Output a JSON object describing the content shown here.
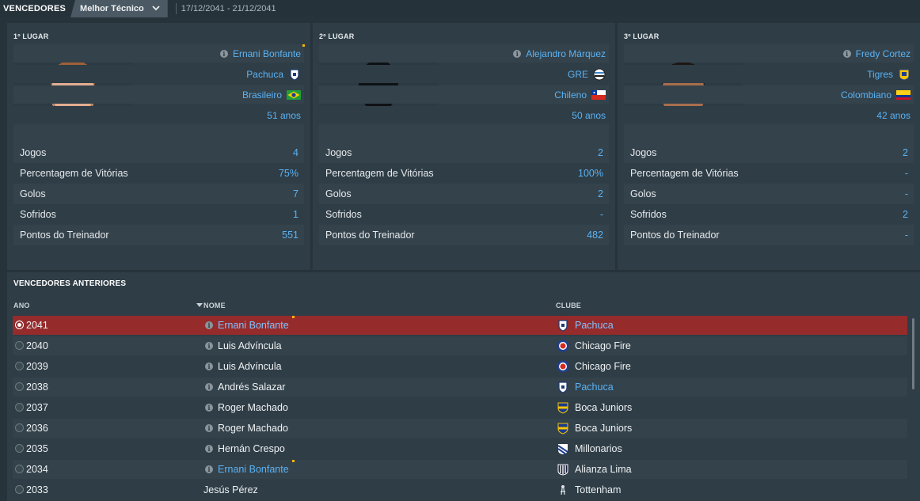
{
  "topbar": {
    "title": "VENCEDORES",
    "dropdown_label": "Melhor Técnico",
    "dates": "17/12/2041 - 21/12/2041"
  },
  "podium": [
    {
      "place": "1º LUGAR",
      "name": "Ernani Bonfante",
      "club": "Pachuca",
      "nationality": "Brasileiro",
      "age": "51 anos",
      "stats": [
        {
          "label": "Jogos",
          "value": "4"
        },
        {
          "label": "Percentagem de Vitórias",
          "value": "75%"
        },
        {
          "label": "Golos",
          "value": "7"
        },
        {
          "label": "Sofridos",
          "value": "1"
        },
        {
          "label": "Pontos do Treinador",
          "value": "551"
        }
      ]
    },
    {
      "place": "2º LUGAR",
      "name": "Alejandro Márquez",
      "club": "GRE",
      "nationality": "Chileno",
      "age": "50 anos",
      "stats": [
        {
          "label": "Jogos",
          "value": "2"
        },
        {
          "label": "Percentagem de Vitórias",
          "value": "100%"
        },
        {
          "label": "Golos",
          "value": "2"
        },
        {
          "label": "Sofridos",
          "value": "-"
        },
        {
          "label": "Pontos do Treinador",
          "value": "482"
        }
      ]
    },
    {
      "place": "3º LUGAR",
      "name": "Fredy Cortez",
      "club": "Tigres",
      "nationality": "Colombiano",
      "age": "42 anos",
      "stats": [
        {
          "label": "Jogos",
          "value": "2"
        },
        {
          "label": "Percentagem de Vitórias",
          "value": "-"
        },
        {
          "label": "Golos",
          "value": "-"
        },
        {
          "label": "Sofridos",
          "value": "2"
        },
        {
          "label": "Pontos do Treinador",
          "value": "-"
        }
      ]
    }
  ],
  "previous": {
    "title": "VENCEDORES ANTERIORES",
    "columns": {
      "year": "ANO",
      "name": "NOME",
      "club": "CLUBE"
    },
    "rows": [
      {
        "year": "2041",
        "name": "Ernani Bonfante",
        "club": "Pachuca"
      },
      {
        "year": "2040",
        "name": "Luis Advíncula",
        "club": "Chicago Fire"
      },
      {
        "year": "2039",
        "name": "Luis Advíncula",
        "club": "Chicago Fire"
      },
      {
        "year": "2038",
        "name": "Andrés Salazar",
        "club": "Pachuca"
      },
      {
        "year": "2037",
        "name": "Roger Machado",
        "club": "Boca Juniors"
      },
      {
        "year": "2036",
        "name": "Roger Machado",
        "club": "Boca Juniors"
      },
      {
        "year": "2035",
        "name": "Hernán Crespo",
        "club": "Millonarios"
      },
      {
        "year": "2034",
        "name": "Ernani Bonfante",
        "club": "Alianza Lima"
      },
      {
        "year": "2033",
        "name": "Jesús Pérez",
        "club": "Tottenham"
      }
    ]
  },
  "colors": {
    "background": "#27333b",
    "panel": "#2f3d46",
    "accent_link": "#5ab3f5",
    "selected_row": "#962b2c",
    "marker": "#f5b800"
  },
  "icons": [
    "info-icon",
    "chevron-down-icon",
    "sort-desc-icon",
    "club-badge-icon",
    "flag-icon",
    "radio-icon"
  ]
}
